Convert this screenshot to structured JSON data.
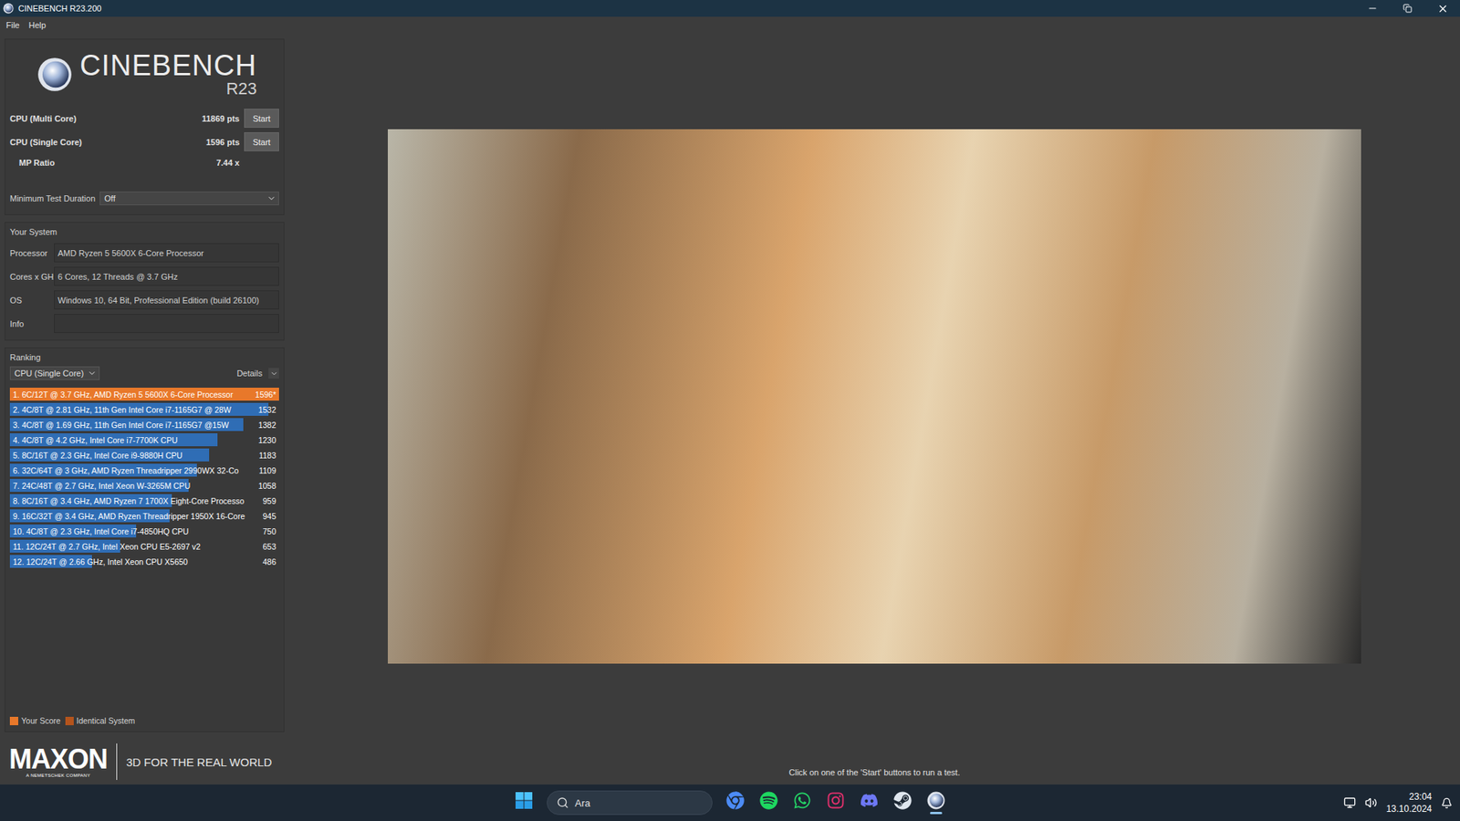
{
  "window": {
    "title": "CINEBENCH R23.200"
  },
  "menu": [
    "File",
    "Help"
  ],
  "logo": {
    "name": "CINEBENCH",
    "version": "R23"
  },
  "tests": [
    {
      "label": "CPU (Multi Core)",
      "score": "11869 pts",
      "button": "Start"
    },
    {
      "label": "CPU (Single Core)",
      "score": "1596 pts",
      "button": "Start"
    }
  ],
  "mp_ratio": {
    "label": "MP Ratio",
    "value": "7.44 x"
  },
  "min_test_duration": {
    "label": "Minimum Test Duration",
    "value": "Off"
  },
  "system": {
    "title": "Your System",
    "fields": [
      {
        "label": "Processor",
        "value": "AMD Ryzen 5 5600X 6-Core Processor"
      },
      {
        "label": "Cores x GHz",
        "value": "6 Cores, 12 Threads @ 3.7 GHz"
      },
      {
        "label": "OS",
        "value": "Windows 10, 64 Bit, Professional Edition (build 26100)"
      },
      {
        "label": "Info",
        "value": ""
      }
    ]
  },
  "ranking": {
    "title": "Ranking",
    "filter": "CPU (Single Core)",
    "details": "Details",
    "rows": [
      {
        "label": "1. 6C/12T @ 3.7 GHz, AMD Ryzen 5 5600X 6-Core Processor",
        "score": "1596*",
        "level": 1.0,
        "color": "#e8782a"
      },
      {
        "label": "2. 4C/8T @ 2.81 GHz, 11th Gen Intel Core i7-1165G7 @ 28W",
        "score": "1532",
        "level": 0.96,
        "color": "#2f6db5"
      },
      {
        "label": "3. 4C/8T @ 1.69 GHz, 11th Gen Intel Core i7-1165G7 @15W",
        "score": "1382",
        "level": 0.866,
        "color": "#2f6db5"
      },
      {
        "label": "4. 4C/8T @ 4.2 GHz, Intel Core i7-7700K CPU",
        "score": "1230",
        "level": 0.771,
        "color": "#2f6db5"
      },
      {
        "label": "5. 8C/16T @ 2.3 GHz, Intel Core i9-9880H CPU",
        "score": "1183",
        "level": 0.741,
        "color": "#2f6db5"
      },
      {
        "label": "6. 32C/64T @ 3 GHz, AMD Ryzen Threadripper 2990WX 32-Co",
        "score": "1109",
        "level": 0.695,
        "color": "#2f6db5"
      },
      {
        "label": "7. 24C/48T @ 2.7 GHz, Intel Xeon W-3265M CPU",
        "score": "1058",
        "level": 0.663,
        "color": "#2f6db5"
      },
      {
        "label": "8. 8C/16T @ 3.4 GHz, AMD Ryzen 7 1700X Eight-Core Processo",
        "score": "959",
        "level": 0.601,
        "color": "#2f6db5"
      },
      {
        "label": "9. 16C/32T @ 3.4 GHz, AMD Ryzen Threadripper 1950X 16-Core",
        "score": "945",
        "level": 0.592,
        "color": "#2f6db5"
      },
      {
        "label": "10. 4C/8T @ 2.3 GHz, Intel Core i7-4850HQ CPU",
        "score": "750",
        "level": 0.47,
        "color": "#2f6db5"
      },
      {
        "label": "11. 12C/24T @ 2.7 GHz, Intel Xeon CPU E5-2697 v2",
        "score": "653",
        "level": 0.409,
        "color": "#2f6db5"
      },
      {
        "label": "12. 12C/24T @ 2.66 GHz, Intel Xeon CPU X5650",
        "score": "486",
        "level": 0.305,
        "color": "#2f6db5"
      }
    ]
  },
  "legend": [
    {
      "label": "Your Score",
      "color": "#e8782a"
    },
    {
      "label": "Identical System",
      "color": "#b5541c"
    }
  ],
  "footer": {
    "brand": "MAXON",
    "sub": "A NEMETSCHEK COMPANY",
    "tagline": "3D FOR THE REAL WORLD"
  },
  "status": "Click on one of the 'Start' buttons to run a test.",
  "taskbar": {
    "search": "Ara",
    "time": "23:04",
    "date": "13.10.2024",
    "apps": [
      {
        "selected": false
      },
      {
        "selected": false
      },
      {
        "selected": false
      },
      {
        "selected": false
      },
      {
        "selected": false
      },
      {
        "selected": false
      },
      {
        "selected": true
      }
    ]
  }
}
